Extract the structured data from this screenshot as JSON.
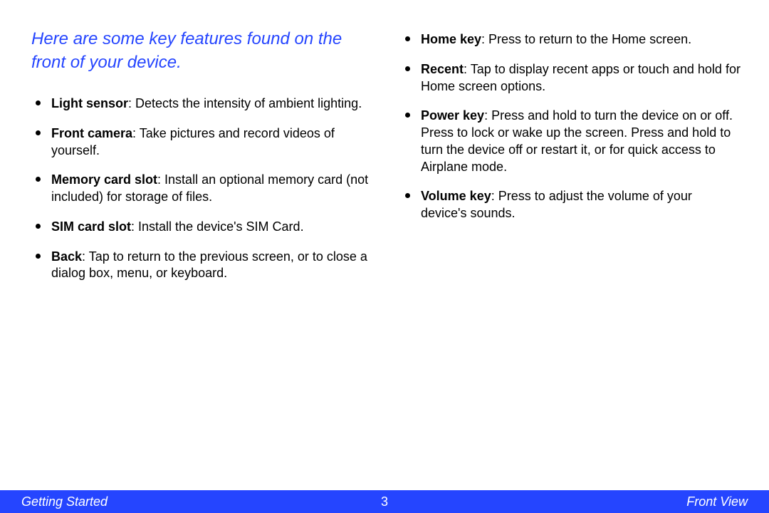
{
  "intro": "Here are some key features found on the front of your device.",
  "leftItems": [
    {
      "term": "Light sensor",
      "desc": ": Detects the intensity of ambient lighting."
    },
    {
      "term": "Front camera",
      "desc": ": Take pictures and record videos of yourself."
    },
    {
      "term": "Memory card slot",
      "desc": ": Install an optional memory card (not included) for storage of files."
    },
    {
      "term": "SIM card slot",
      "desc": ": Install the device's SIM Card."
    },
    {
      "term": "Back",
      "desc": ": Tap to return to the previous screen, or to close a dialog box, menu, or keyboard."
    }
  ],
  "rightItems": [
    {
      "term": "Home key",
      "desc": ": Press to return to the Home screen."
    },
    {
      "term": "Recent",
      "desc": ": Tap to display recent apps or touch and hold for Home screen options."
    },
    {
      "term": "Power key",
      "desc": ": Press and hold to turn the device on or off. Press to lock or wake up the screen. Press and hold to turn the device off or restart it, or for quick access to Airplane mode."
    },
    {
      "term": "Volume key",
      "desc": ": Press to adjust the volume of your device's sounds."
    }
  ],
  "footer": {
    "left": "Getting Started",
    "center": "3",
    "right": "Front View"
  }
}
